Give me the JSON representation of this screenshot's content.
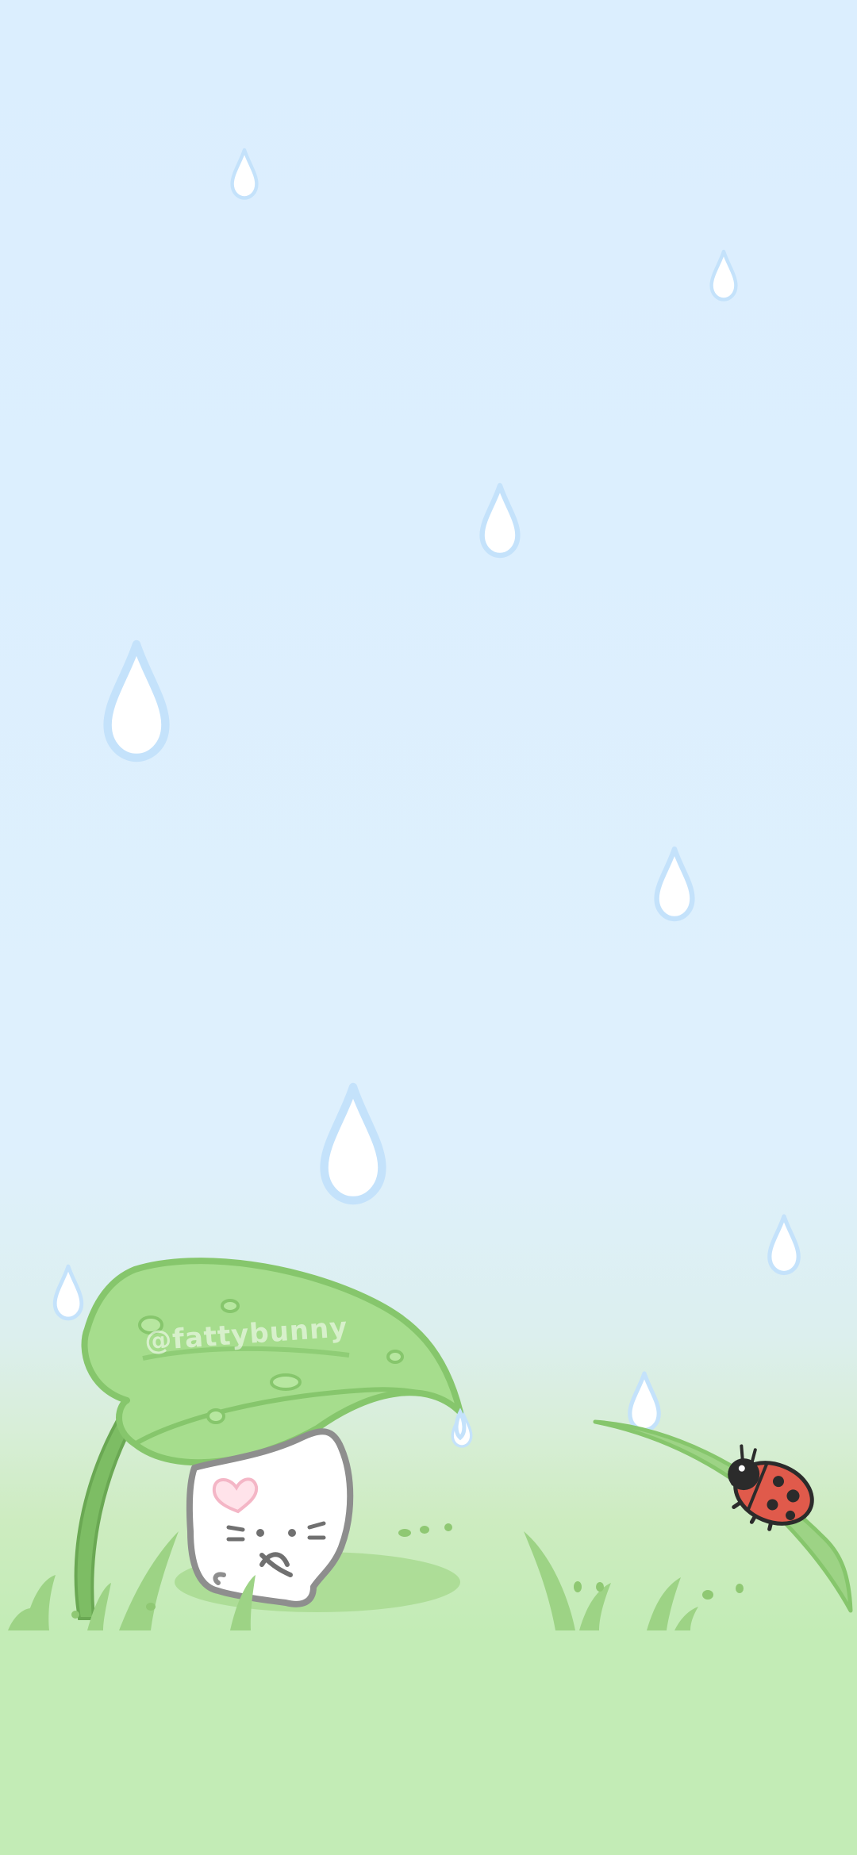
{
  "scene": {
    "watermark": "@fattybunny",
    "colors": {
      "sky_top": "#dbeefe",
      "sky_bottom": "#def0fd",
      "grass": "#c3ecb6",
      "leaf": "#9bd483",
      "leaf_dark": "#6fb05a",
      "raindrop_fill": "#ffffff",
      "raindrop_outline": "#c4e2fb",
      "ladybug_red": "#e05a4b",
      "ladybug_black": "#2b2b2b"
    },
    "objects": [
      "raindrops",
      "leaf-umbrella",
      "white-cat",
      "grass-tufts",
      "grass-blade",
      "ladybug"
    ]
  }
}
